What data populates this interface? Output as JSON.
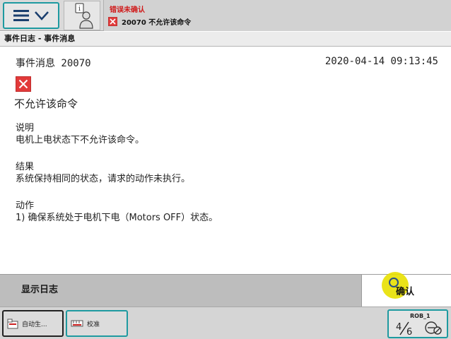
{
  "topbar": {
    "menu_icons": [
      "hamburger-icon",
      "chevron-down-icon"
    ],
    "operator_icon": "operator-info-icon"
  },
  "status": {
    "title": "错误未确认",
    "message": "20070 不允许该命令",
    "icon": "error-x-icon"
  },
  "breadcrumb": "事件日志 - 事件消息",
  "event": {
    "header": "事件消息 20070",
    "timestamp": "2020-04-14 09:13:45",
    "title": "不允许该命令",
    "sections": [
      {
        "heading": "说明",
        "body": "电机上电状态下不允许该命令。"
      },
      {
        "heading": "结果",
        "body": "系统保持相同的状态，请求的动作未执行。"
      },
      {
        "heading": "动作",
        "body": "1) 确保系统处于电机下电（Motors OFF）状态。"
      }
    ]
  },
  "commands": {
    "show_log": "显示日志",
    "confirm": "确认"
  },
  "taskbar": {
    "tasks": [
      {
        "label": "自动生...",
        "icon": "auto-production-icon"
      },
      {
        "label": "校准",
        "icon": "calibration-icon"
      }
    ],
    "quickset": {
      "robot": "ROB_1",
      "speed": "1/6"
    }
  },
  "colors": {
    "accent": "#1e9aa0",
    "error": "#e23c3c",
    "status_text": "#d01b1b"
  }
}
